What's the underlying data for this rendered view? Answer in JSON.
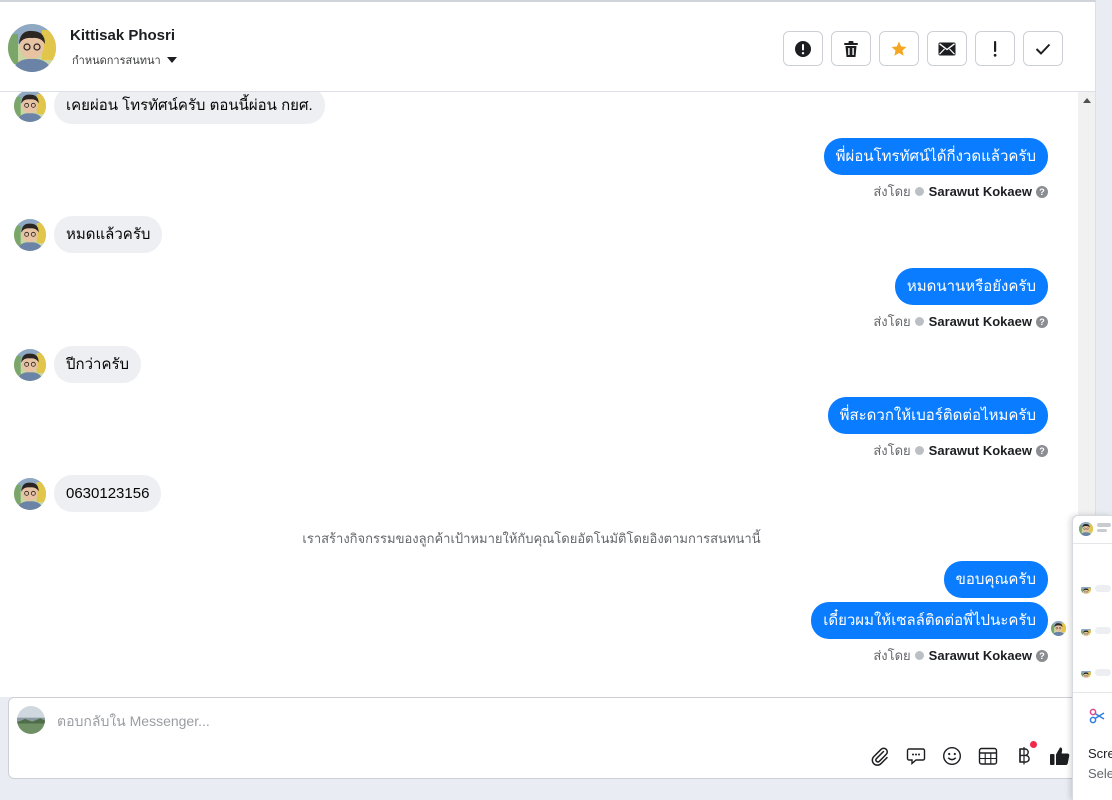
{
  "header": {
    "contact_name": "Kittisak Phosri",
    "assign_label": "กำหนดการสนทนา",
    "actions": [
      {
        "name": "mark-spam-button",
        "icon": "alert-circle-icon"
      },
      {
        "name": "delete-button",
        "icon": "trash-icon"
      },
      {
        "name": "star-button",
        "icon": "star-icon"
      },
      {
        "name": "mark-unread-button",
        "icon": "envelope-icon"
      },
      {
        "name": "follow-up-button",
        "icon": "exclamation-icon"
      },
      {
        "name": "mark-done-button",
        "icon": "check-icon"
      }
    ]
  },
  "messages": {
    "m1_in": "เคยผ่อน โทรทัศน์ครับ ตอนนี้ผ่อน กยศ.",
    "m2_out": "พี่ผ่อนโทรทัศน์ได้กี่งวดแล้วครับ",
    "m3_in": "หมดแล้วครับ",
    "m4_out": "หมดนานหรือยังครับ",
    "m5_in": "ปีกว่าครับ",
    "m6_out": "พี่สะดวกให้เบอร์ติดต่อไหมครับ",
    "m7_in": "0630123156",
    "system_note": "เราสร้างกิจกรรมของลูกค้าเป้าหมายให้กับคุณโดยอัตโนมัติโดยอิงตามการสนทนานี้",
    "m8_out": "ขอบคุณครับ",
    "m9_out": "เดี๋ยวผมให้เซลล์ติดต่อพี่ไปนะครับ"
  },
  "sent_by": {
    "prefix": "ส่งโดย",
    "agent": "Sarawut Kokaew",
    "help": "?"
  },
  "composer": {
    "placeholder": "ตอบกลับใน Messenger...",
    "tools": [
      "paperclip-icon",
      "saved-reply-icon",
      "emoji-icon",
      "calendar-icon",
      "baht-payment-icon",
      "thumbs-up-icon"
    ]
  },
  "overlay": {
    "label": "Scre",
    "sub": "Sele"
  },
  "colors": {
    "outgoing_bubble": "#0a7cff",
    "incoming_bubble": "#eeeff2",
    "star": "#f5a623",
    "notification_dot": "#f02849"
  }
}
